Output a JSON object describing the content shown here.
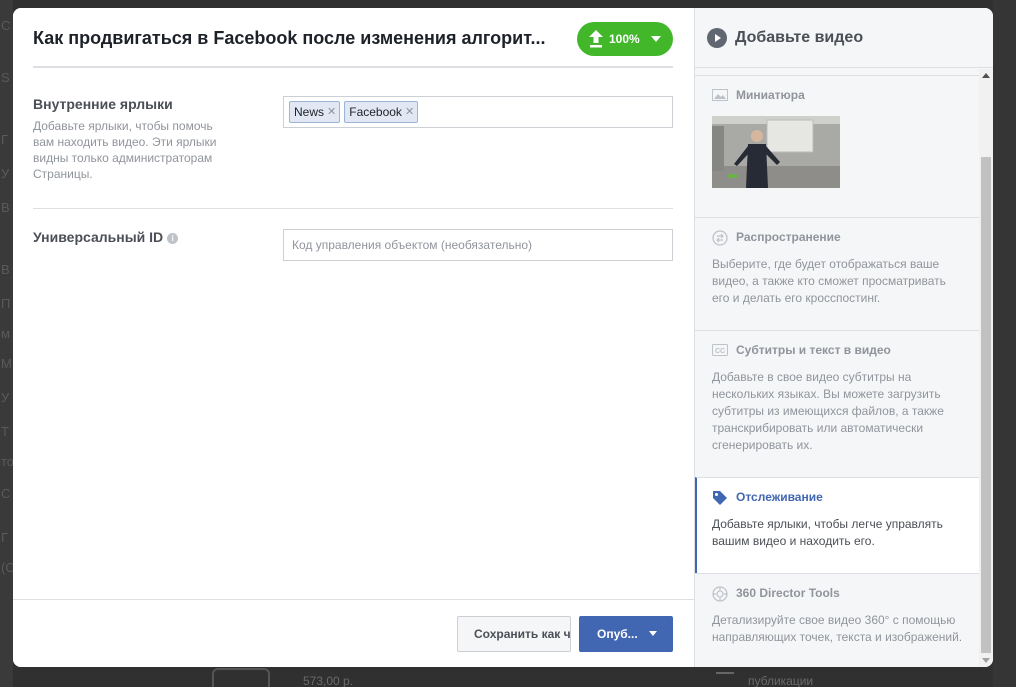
{
  "header": {
    "title": "Как продвигаться в Facebook после изменения алгорит...",
    "upload_percent": "100%"
  },
  "tags_field": {
    "label": "Внутренние ярлыки",
    "help": "Добавьте ярлыки, чтобы помочь вам находить видео. Эти ярлыки видны только администраторам Страницы.",
    "tags": [
      "News",
      "Facebook"
    ]
  },
  "id_field": {
    "label": "Универсальный ID",
    "placeholder": "Код управления объектом (необязательно)"
  },
  "footer": {
    "save_draft_label": "Сохранить как черновик",
    "publish_label": "Опуб..."
  },
  "right_panel": {
    "title": "Добавьте видео",
    "sections": [
      {
        "title": "Миниатюра",
        "icon": "image-icon"
      },
      {
        "title": "Распространение",
        "icon": "share-icon",
        "desc": "Выберите, где будет отображаться ваше видео, а также кто сможет просматривать его и делать его кросспостинг."
      },
      {
        "title": "Субтитры и текст в видео",
        "icon": "cc-icon",
        "desc": "Добавьте в свое видео субтитры на нескольких языках. Вы можете загрузить субтитры из имеющихся файлов, а также транскрибировать или автоматически сгенерировать их."
      },
      {
        "title": "Отслеживание",
        "icon": "tag-icon",
        "desc": "Добавьте ярлыки, чтобы легче управлять вашим видео и находить его."
      },
      {
        "title": "360 Director Tools",
        "icon": "360-icon",
        "desc": "Детализируйте свое видео 360° с помощью направляющих точек, текста и изображений."
      }
    ]
  },
  "background": {
    "letters": [
      "С",
      "S",
      "Г",
      "У",
      "В",
      "В",
      "П",
      "м",
      "М",
      "У",
      "Т",
      "то",
      "С",
      "Г",
      "(С"
    ],
    "price": "573,00 р.",
    "publications": "публикации"
  },
  "colors": {
    "upload_green": "#42b72a",
    "publish_blue": "#4267b2",
    "active_blue": "#4267b2"
  }
}
